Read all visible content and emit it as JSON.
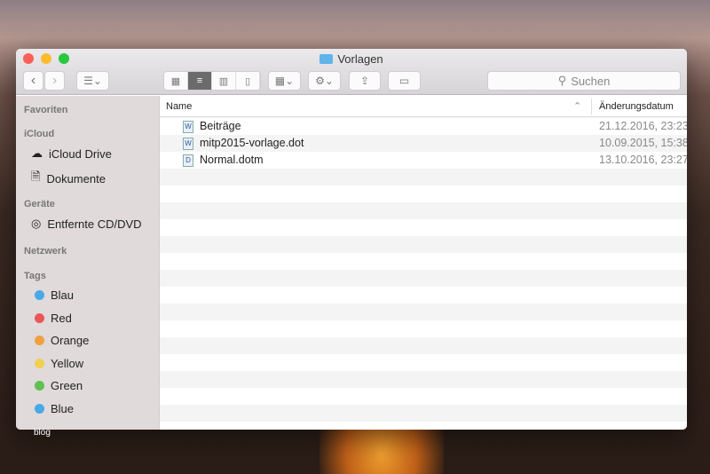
{
  "window": {
    "title": "Vorlagen"
  },
  "toolbar": {
    "back": "‹",
    "forward": "›",
    "search_placeholder": "Suchen"
  },
  "sidebar": {
    "sections": {
      "favorites": "Favoriten",
      "icloud": "iCloud",
      "devices": "Geräte",
      "network": "Netzwerk",
      "tags": "Tags"
    },
    "icloud_items": [
      {
        "label": "iCloud Drive"
      },
      {
        "label": "Dokumente"
      }
    ],
    "device_items": [
      {
        "label": "Entfernte CD/DVD"
      }
    ],
    "tags": [
      {
        "label": "Blau",
        "color": "#4aa8e8"
      },
      {
        "label": "Red",
        "color": "#e85858"
      },
      {
        "label": "Orange",
        "color": "#f0a040"
      },
      {
        "label": "Yellow",
        "color": "#f0d050"
      },
      {
        "label": "Green",
        "color": "#60c050"
      },
      {
        "label": "Blue",
        "color": "#4aa8e8"
      }
    ]
  },
  "columns": {
    "name": "Name",
    "date": "Änderungsdatum"
  },
  "files": [
    {
      "name": "Beiträge",
      "date": "21.12.2016, 23:23"
    },
    {
      "name": "mitp2015-vorlage.dot",
      "date": "10.09.2015, 15:38"
    },
    {
      "name": "Normal.dotm",
      "date": "13.10.2016, 23:27"
    }
  ],
  "watermark": "blog"
}
